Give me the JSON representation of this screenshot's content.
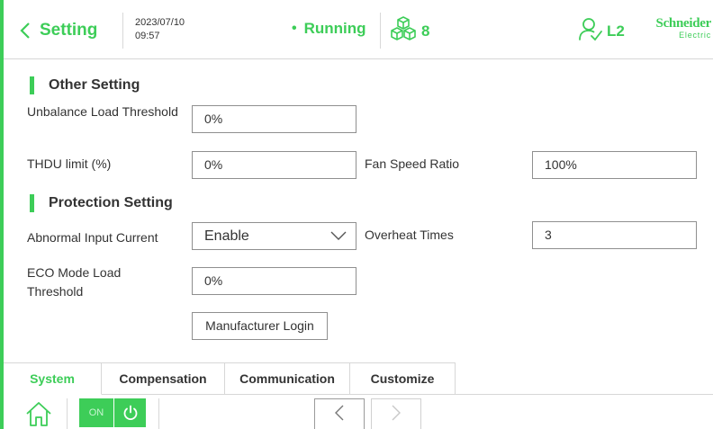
{
  "header": {
    "back_label": "Setting",
    "date": "2023/07/10",
    "time": "09:57",
    "status_dot": "•",
    "status": "Running",
    "module_count": "8",
    "user_level": "L2",
    "brand_line1": "Schneider",
    "brand_line2": "Electric",
    "accent_color": "#3dcd58"
  },
  "other_setting": {
    "title": "Other Setting",
    "unbalance_label": "Unbalance Load Threshold",
    "unbalance_value": "0%",
    "thdu_label": "THDU limit (%)",
    "thdu_value": "0%",
    "fan_label": "Fan Speed Ratio",
    "fan_value": "100%"
  },
  "protection_setting": {
    "title": "Protection Setting",
    "abnormal_label": "Abnormal Input Current",
    "abnormal_value": "Enable",
    "overheat_label": "Overheat Times",
    "overheat_value": "3",
    "eco_label": "ECO Mode Load Threshold",
    "eco_value": "0%",
    "manufacturer_button": "Manufacturer Login"
  },
  "tabs": [
    "System",
    "Compensation",
    "Communication",
    "Customize"
  ],
  "bottom": {
    "power_on_label": "ON"
  },
  "icons": [
    "chevron-left-icon",
    "modules-icon",
    "user-check-icon",
    "chevron-down-icon",
    "home-icon",
    "power-icon",
    "chevron-right-icon"
  ]
}
